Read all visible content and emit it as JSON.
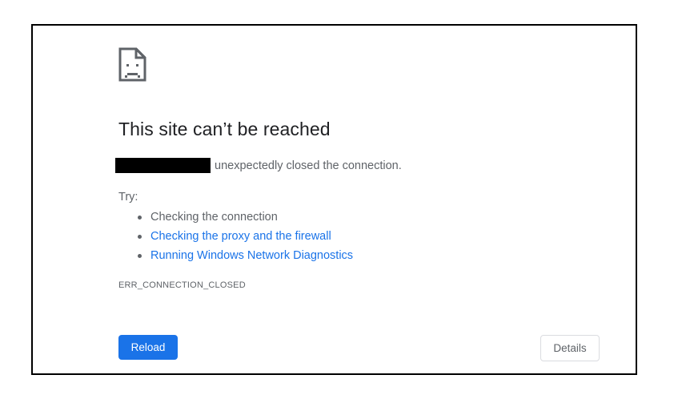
{
  "error_page": {
    "icon": "sad-page-icon",
    "title": "This site can’t be reached",
    "description_suffix": "unexpectedly closed the connection.",
    "try_label": "Try:",
    "suggestions": [
      {
        "text": "Checking the connection",
        "is_link": false
      },
      {
        "text": "Checking the proxy and the firewall",
        "is_link": true
      },
      {
        "text": "Running Windows Network Diagnostics",
        "is_link": true
      }
    ],
    "error_code": "ERR_CONNECTION_CLOSED",
    "reload_label": "Reload",
    "details_label": "Details"
  },
  "colors": {
    "frame_border": "#000000",
    "title_text": "#202124",
    "body_text": "#5f6368",
    "link": "#1a73e8",
    "primary_button": "#1a73e8",
    "secondary_button_border": "#dadce0",
    "redaction": "#000000"
  }
}
